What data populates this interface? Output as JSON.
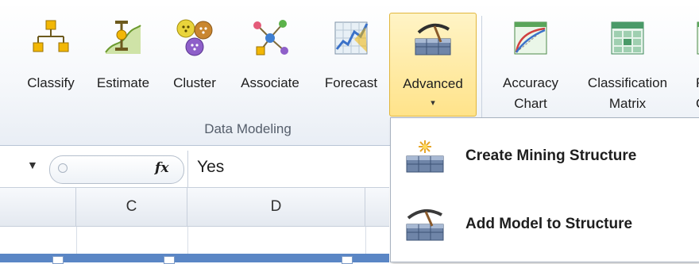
{
  "ribbon": {
    "buttons": [
      {
        "label": "Classify",
        "icon": "classify-icon"
      },
      {
        "label": "Estimate",
        "icon": "estimate-icon"
      },
      {
        "label": "Cluster",
        "icon": "cluster-icon"
      },
      {
        "label": "Associate",
        "icon": "associate-icon"
      },
      {
        "label": "Forecast",
        "icon": "forecast-icon"
      },
      {
        "label": "Advanced",
        "icon": "advanced-icon",
        "chevron": "▾",
        "active": true
      },
      {
        "label": "Accuracy",
        "label2": "Chart",
        "icon": "accuracy-chart-icon"
      },
      {
        "label": "Classification",
        "label2": "Matrix",
        "icon": "classification-matrix-icon"
      },
      {
        "label": "P",
        "label2": "C",
        "icon": "profit-chart-icon"
      }
    ],
    "group_label": "Data Modeling"
  },
  "formula_bar": {
    "fx_label": "fx",
    "value": "Yes"
  },
  "grid": {
    "columns": [
      "C",
      "D"
    ]
  },
  "advanced_menu": {
    "items": [
      {
        "label": "Create Mining Structure",
        "icon": "create-mining-structure-icon"
      },
      {
        "label": "Add Model to Structure",
        "icon": "add-model-to-structure-icon"
      }
    ]
  },
  "colors": {
    "active_button_bg": "#ffe38a",
    "selection_row": "#5a86c5",
    "ribbon_border": "#b9c5d6"
  }
}
